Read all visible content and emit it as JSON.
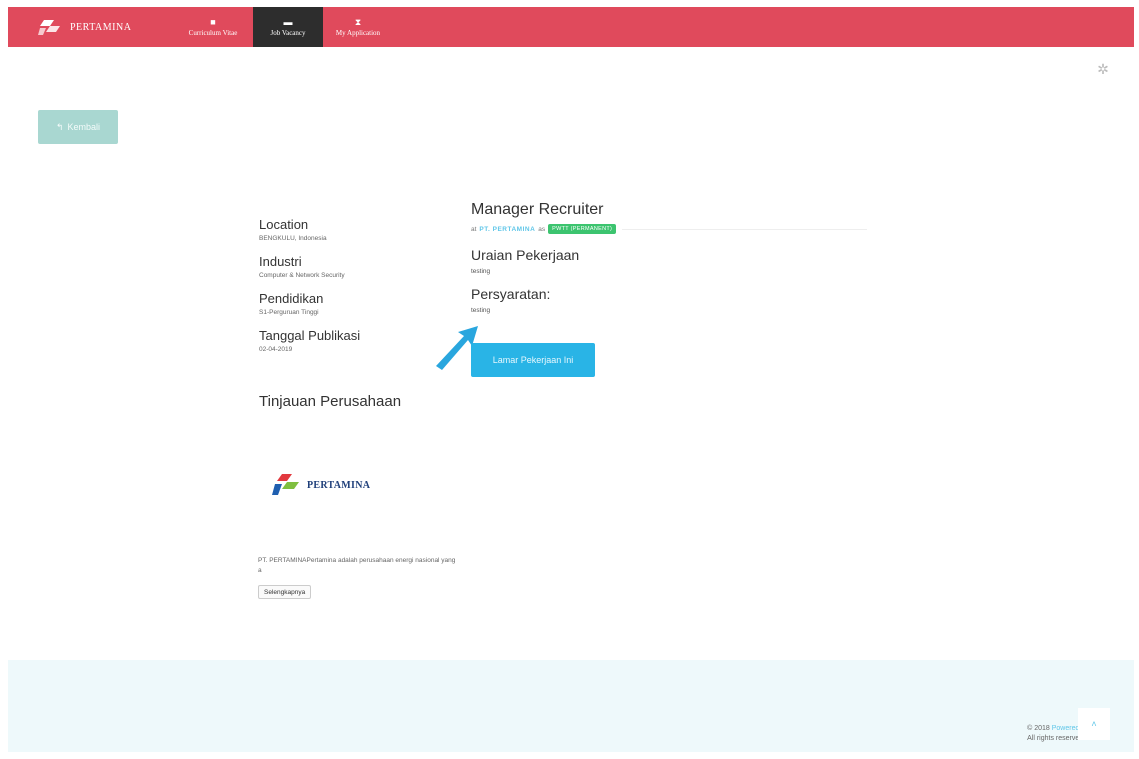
{
  "navbar": {
    "brand": "PERTAMINA",
    "items": [
      {
        "label": "Curriculum Vitae",
        "icon": "folder-icon"
      },
      {
        "label": "Job Vacancy",
        "icon": "briefcase-icon",
        "active": true
      },
      {
        "label": "My Application",
        "icon": "hourglass-icon"
      }
    ]
  },
  "back_button": {
    "label": "Kembali",
    "icon": "reply-icon"
  },
  "info": {
    "location_title": "Location",
    "location_value": "BENGKULU, Indonesia",
    "industry_title": "Industri",
    "industry_value": "Computer & Network Security",
    "education_title": "Pendidikan",
    "education_value": "S1-Perguruan Tinggi",
    "published_title": "Tanggal Publikasi",
    "published_value": "02-04-2019"
  },
  "company": {
    "section_title": "Tinjauan Perusahaan",
    "logo_name": "PERTAMINA",
    "description": "PT. PERTAMINAPertamina adalah perusahaan energi nasional yang a",
    "more_label": "Selengkapnya"
  },
  "job": {
    "title": "Manager Recruiter",
    "at_text": "at",
    "company": "PT. PERTAMINA",
    "as_text": "as",
    "employment_type": "PWTT (PERMANENT)",
    "description_title": "Uraian Pekerjaan",
    "description_text": "testing",
    "requirements_title": "Persyaratan:",
    "requirements_text": "testing",
    "apply_label": "Lamar Pekerjaan Ini"
  },
  "footer": {
    "copyright": "© 2018",
    "powered": "Powered B",
    "rights": "All rights reserved"
  },
  "colors": {
    "navbar": "#e04a5c",
    "nav_active": "#2d2d2d",
    "back_button": "#a9d7d1",
    "apply_button": "#29b4e6",
    "badge": "#3cc46f",
    "footer": "#eef9fb"
  }
}
